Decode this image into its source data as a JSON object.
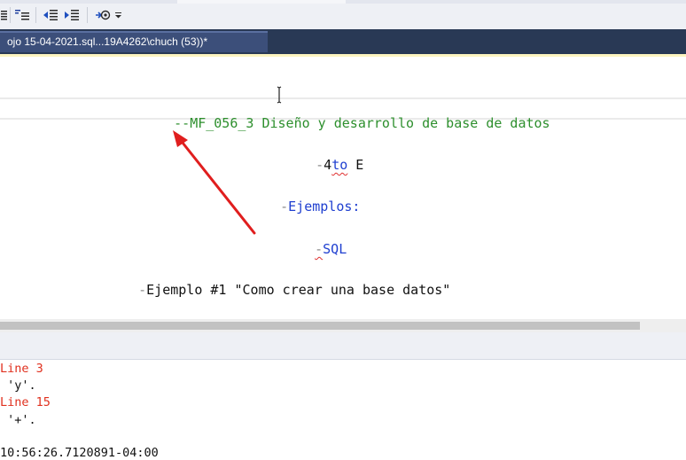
{
  "toolbar": {
    "icons": [
      "align-icon",
      "comment-lines-icon",
      "decrease-indent-icon",
      "increase-indent-icon",
      "specify-template-icon",
      "dropdown-chevron-icon"
    ]
  },
  "tab": {
    "label": "ojo 15-04-2021.sql...19A4262\\chuch (53))*"
  },
  "editor": {
    "lines": {
      "title_prefix": "--",
      "title_text": "MF_056_3 Diseño y desarrollo de base de datos",
      "l2_dash": "-",
      "l2_num": "4",
      "l2_word": "to",
      "l2_rest": " E",
      "l3_dash": "-",
      "l3_text": "Ejemplos:",
      "l4_dash": "-",
      "l4_text": "SQL",
      "l5_dash": "-",
      "l5_text": "Ejemplo #1 \"Como crear una base datos\""
    }
  },
  "messages": {
    "lines": [
      "Line 3",
      " 'y'.",
      "Line 15",
      " '+'."
    ],
    "partial_line": "10:56:26.7120891-04:00"
  },
  "colors": {
    "comment": "#2d8f2d",
    "keyword": "#1f3fd0",
    "error": "#e0301e",
    "tab_bar": "#293955",
    "annotation_arrow": "#e01e1e"
  }
}
